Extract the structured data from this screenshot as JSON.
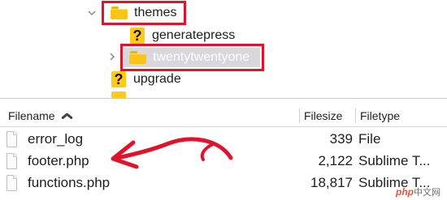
{
  "tree": {
    "items": [
      {
        "label": "themes",
        "icon": "folder-icon",
        "expanded": true
      },
      {
        "label": "generatepress",
        "icon": "unknown-file-icon"
      },
      {
        "label": "twentytwentyone",
        "icon": "folder-icon",
        "selected": true
      },
      {
        "label": "upgrade",
        "icon": "unknown-file-icon"
      }
    ],
    "highlight_color": "#e0132b"
  },
  "file_list": {
    "columns": {
      "filename": "Filename",
      "filesize": "Filesize",
      "filetype": "Filetype"
    },
    "sort": "ascending",
    "rows": [
      {
        "name": "error_log",
        "size": "339",
        "type": "File"
      },
      {
        "name": "footer.php",
        "size": "2,122",
        "type": "Sublime T..."
      },
      {
        "name": "functions.php",
        "size": "18,817",
        "type": "Sublime T..."
      }
    ]
  },
  "annotation": {
    "arrow_color": "#e0132b",
    "points_to": "footer.php"
  },
  "watermark": {
    "brand": "php",
    "suffix": "中文网"
  }
}
